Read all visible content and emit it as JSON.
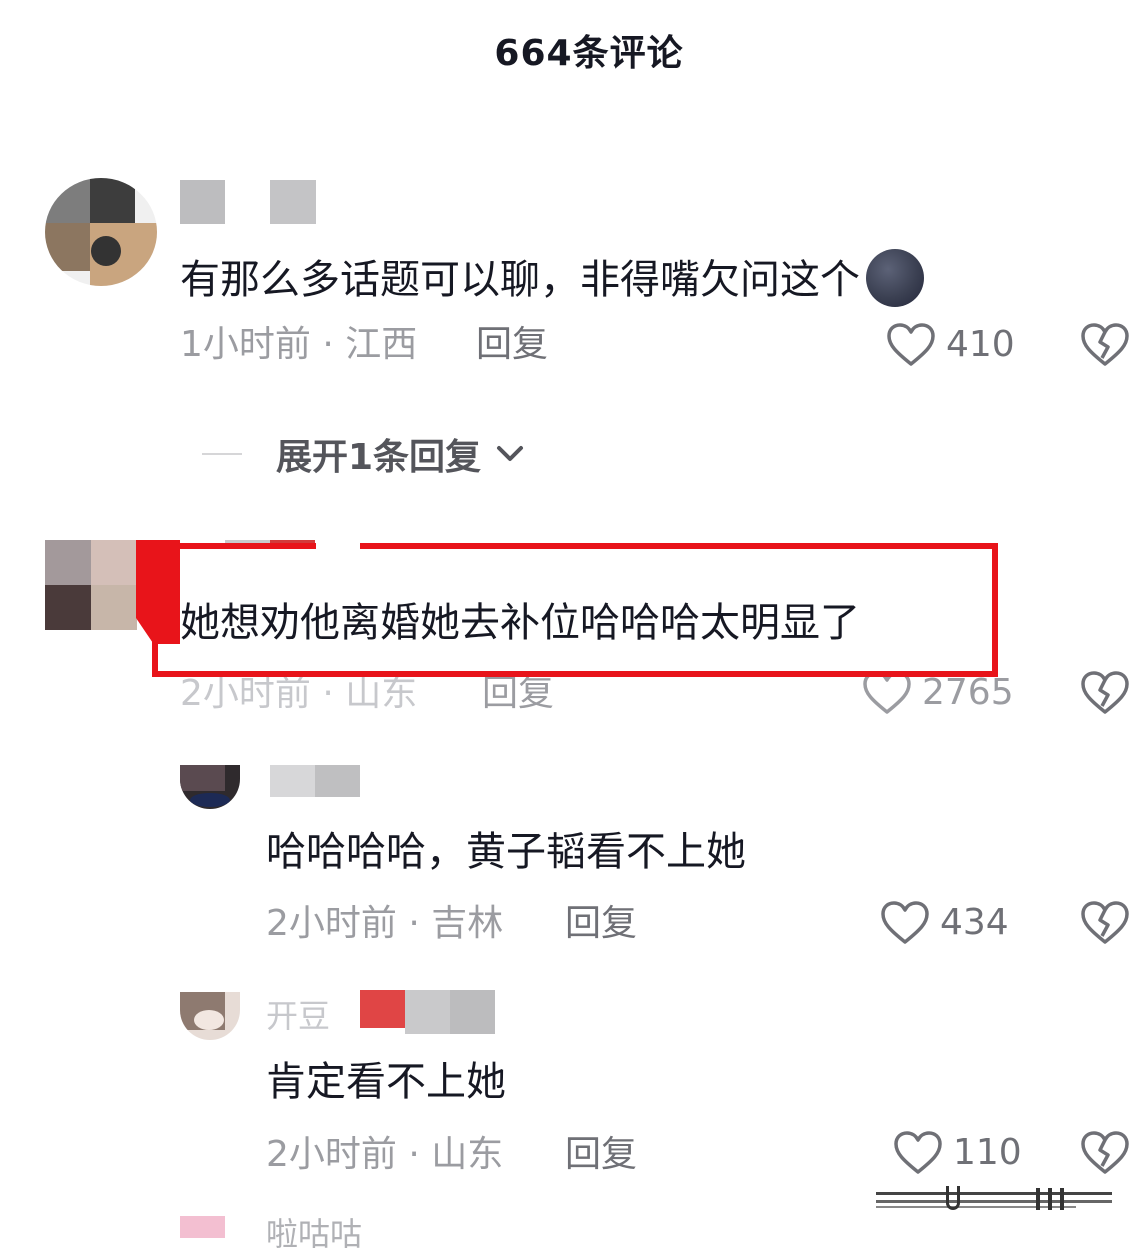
{
  "header": {
    "title": "664条评论"
  },
  "comments": [
    {
      "text": "有那么多话题可以聊，非得嘴欠问这个",
      "time_location": "1小时前 · 江西",
      "reply_label": "回复",
      "likes": "410",
      "emoji": "new-moon-face-emoji"
    },
    {
      "text": "她想劝他离婚她去补位哈哈哈太明显了",
      "time_location": "2小时前 · 山东",
      "reply_label": "回复",
      "likes": "2765",
      "highlighted": true
    }
  ],
  "expand_replies": {
    "label": "展开1条回复"
  },
  "replies": [
    {
      "text": "哈哈哈哈，黄子韬看不上她",
      "time_location": "2小时前 · 吉林",
      "reply_label": "回复",
      "likes": "434"
    },
    {
      "username_partial": "开豆",
      "text": "肯定看不上她",
      "time_location": "2小时前 · 山东",
      "reply_label": "回复",
      "likes": "110"
    }
  ],
  "next_user_partial": "啦咕咕",
  "colors": {
    "highlight_border": "#e8141a",
    "text_primary": "#161823",
    "text_secondary": "#9b9ca1",
    "icon_gray": "#6f7076"
  },
  "icons": [
    "heart-outline-icon",
    "broken-heart-icon",
    "chevron-down-icon"
  ]
}
